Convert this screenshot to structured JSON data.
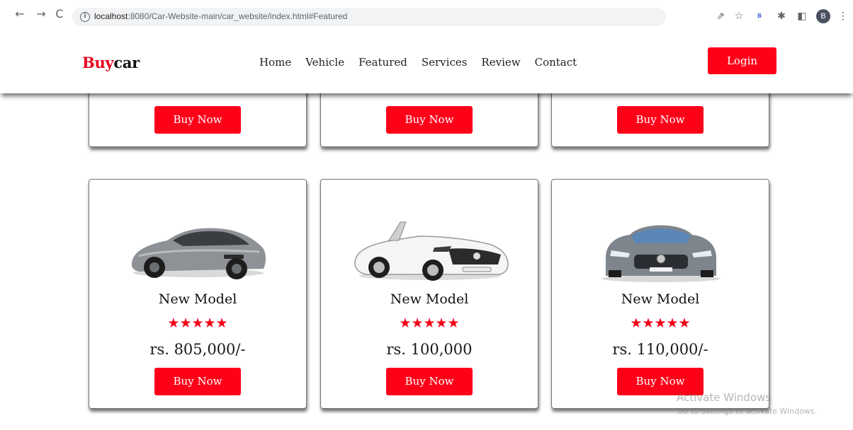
{
  "browser": {
    "back_icon": "←",
    "forward_icon": "→",
    "reload_icon": "C",
    "url_host": "localhost",
    "url_path": ":8080/Car-Website-main/car_website/index.html#Featured",
    "share_icon": "⇗",
    "star_icon": "☆",
    "bookmark_label": "B",
    "extensions_icon": "✱",
    "sidepanel_icon": "◧",
    "profile_initial": "B",
    "menu_icon": "⋮"
  },
  "header": {
    "logo_accent": "Buy",
    "logo_rest": "car",
    "nav": [
      "Home",
      "Vehicle",
      "Featured",
      "Services",
      "Review",
      "Contact"
    ],
    "login_label": "Login"
  },
  "top_cards": {
    "buy_label": "Buy Now"
  },
  "cards": [
    {
      "title": "New Model",
      "stars": "★★★★★",
      "price": "rs. 805,000/-",
      "buy_label": "Buy Now",
      "car_color": "#8a8d92"
    },
    {
      "title": "New Model",
      "stars": "★★★★★",
      "price": "rs. 100,000",
      "buy_label": "Buy Now",
      "car_color": "#f2f2f2"
    },
    {
      "title": "New Model",
      "stars": "★★★★★",
      "price": "rs. 110,000/-",
      "buy_label": "Buy Now",
      "car_color": "#7d838a"
    }
  ],
  "watermark": {
    "title": "Activate Windows",
    "subtitle": "Go to Settings to activate Windows."
  },
  "colors": {
    "accent": "#ff0019",
    "text": "#111111"
  }
}
